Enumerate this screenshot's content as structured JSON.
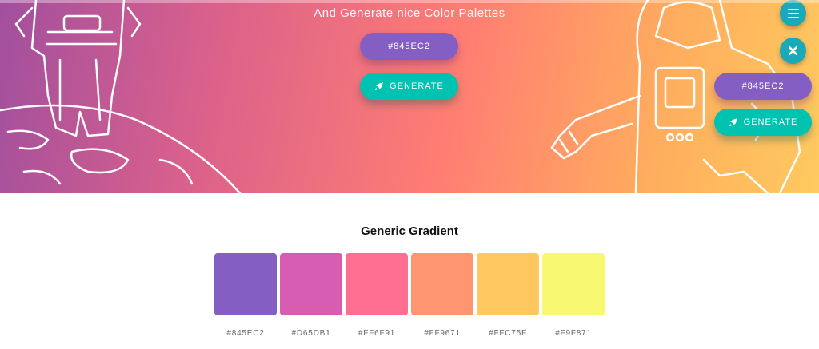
{
  "hero": {
    "tagline": "And Generate nice Color Palettes",
    "center_color_value": "#845EC2",
    "center_generate_label": "GENERATE",
    "right_color_value": "#845EC2",
    "right_generate_label": "GENERATE"
  },
  "fabs": [
    {
      "icon": "menu-icon"
    },
    {
      "icon": "close-icon"
    }
  ],
  "palette": {
    "title": "Generic Gradient",
    "colors": [
      "#845EC2",
      "#D65DB1",
      "#FF6F91",
      "#FF9671",
      "#FFC75F",
      "#F9F871"
    ]
  },
  "colors": {
    "primary": "#845ec2",
    "accent": "#00c2b0",
    "fab": "#1aa9b8"
  }
}
